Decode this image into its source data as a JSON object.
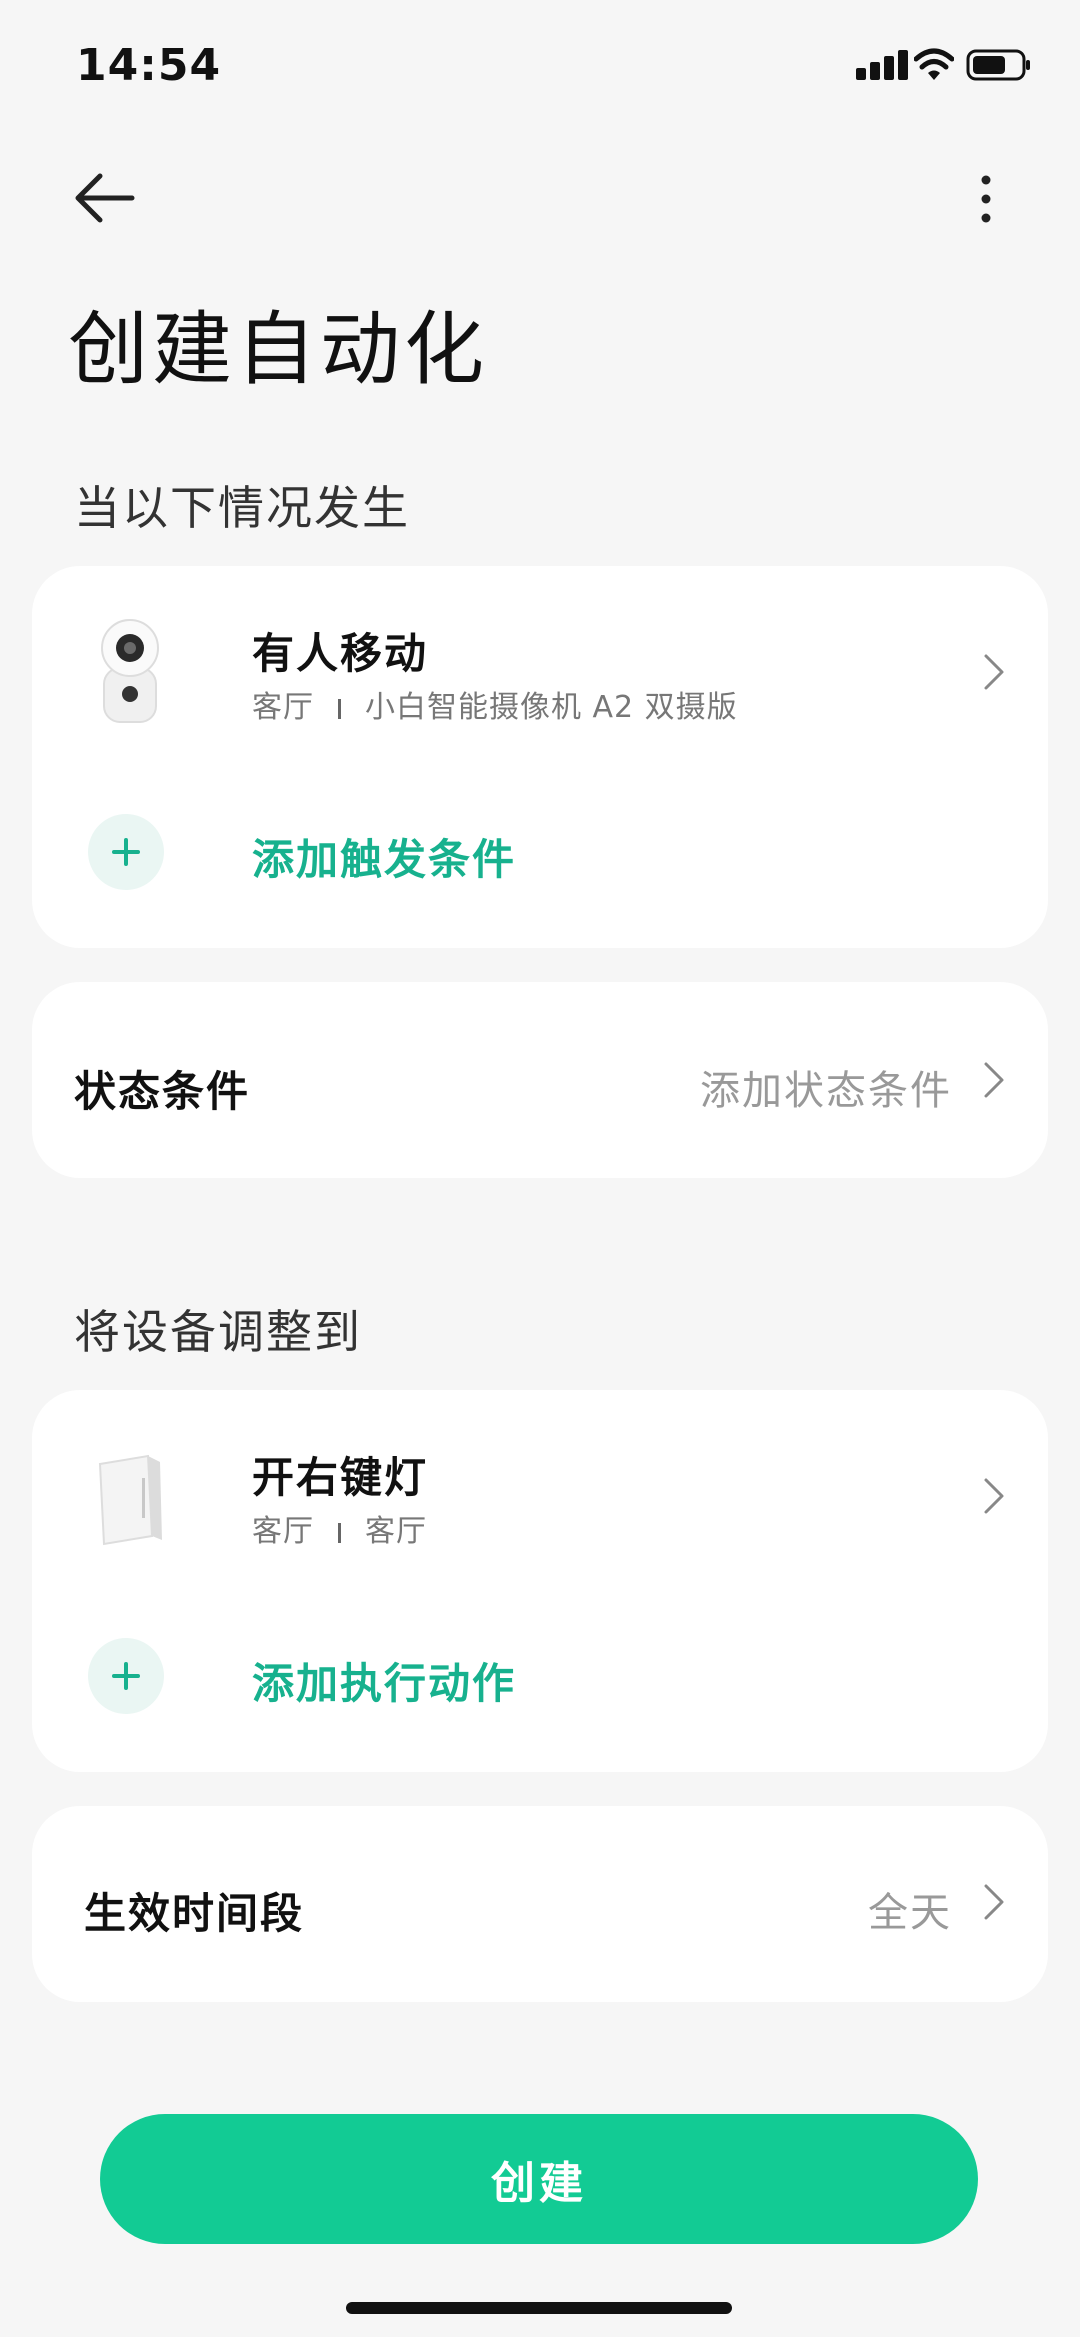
{
  "status_bar": {
    "time": "14:54"
  },
  "header": {
    "title": "创建自动化"
  },
  "trigger_section": {
    "title": "当以下情况发生",
    "device": {
      "title": "有人移动",
      "room": "客厅",
      "device_name": "小白智能摄像机 A2 双摄版"
    },
    "add_label": "添加触发条件"
  },
  "state_condition": {
    "label": "状态条件",
    "value": "添加状态条件"
  },
  "action_section": {
    "title": "将设备调整到",
    "device": {
      "title": "开右键灯",
      "room": "客厅",
      "location": "客厅"
    },
    "add_label": "添加执行动作"
  },
  "time_period": {
    "label": "生效时间段",
    "value": "全天"
  },
  "create_button": {
    "label": "创建"
  },
  "colors": {
    "accent": "#12cb94",
    "accent_text": "#17b18e",
    "background": "#f6f6f6"
  }
}
